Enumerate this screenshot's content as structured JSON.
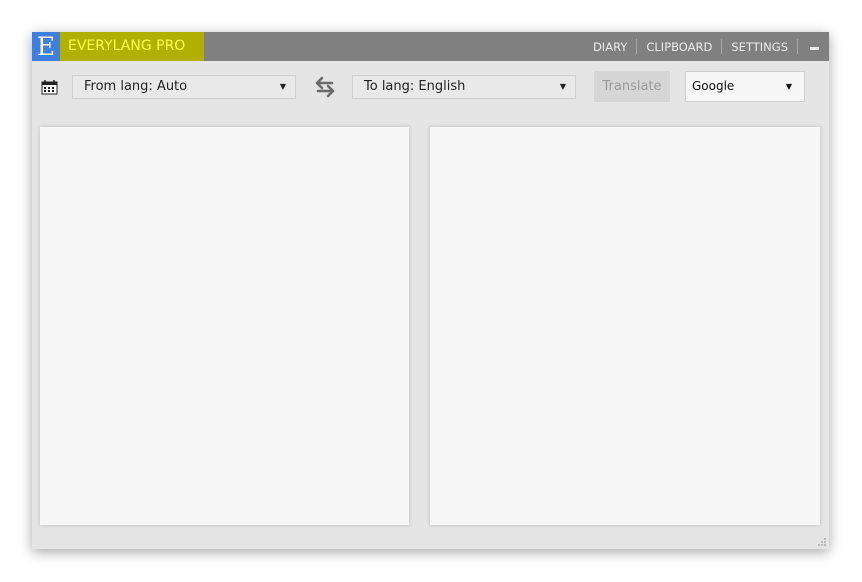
{
  "app": {
    "logo_letter": "E",
    "title": "EVERYLANG PRO"
  },
  "nav": {
    "diary": "DIARY",
    "clipboard": "CLIPBOARD",
    "settings": "SETTINGS"
  },
  "toolbar": {
    "from_lang": "From lang: Auto",
    "to_lang": "To lang: English",
    "translate_label": "Translate",
    "engine": "Google"
  },
  "icons": {
    "history": "history-icon",
    "swap": "swap-arrows-icon",
    "minimize": "minimize-icon",
    "resize": "resize-grip-icon"
  },
  "colors": {
    "titlebar": "#808080",
    "logo_bg": "#3f7fe0",
    "highlight": "#b0b000",
    "highlight_text": "#ffff40",
    "window_bg": "#e5e5e5",
    "pane_bg": "#f7f7f7"
  },
  "panes": {
    "source_text": "",
    "target_text": ""
  }
}
